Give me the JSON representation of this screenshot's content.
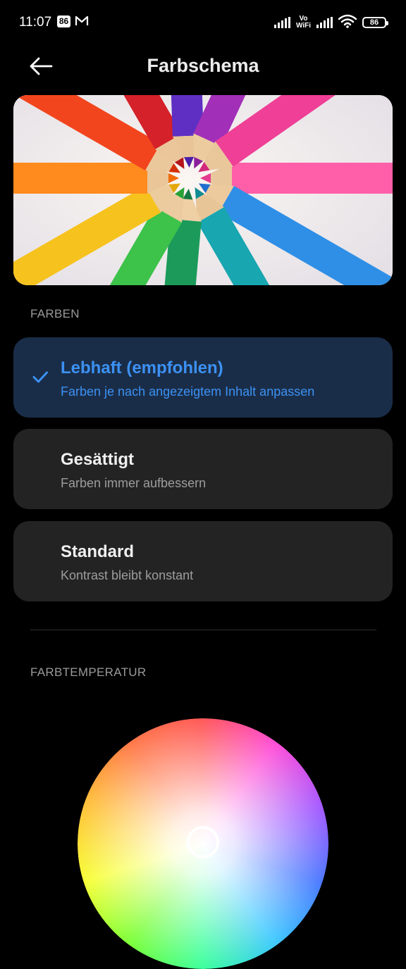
{
  "status_bar": {
    "time": "11:07",
    "badge": "86",
    "mail_icon": "gmail-m-icon",
    "vowifi": [
      "Vo",
      "WiFi"
    ],
    "battery": "86"
  },
  "header": {
    "title": "Farbschema",
    "back_icon": "arrow-left-icon"
  },
  "colors_section": {
    "label": "FARBEN",
    "options": [
      {
        "title": "Lebhaft (empfohlen)",
        "subtitle": "Farben je nach angezeigtem Inhalt anpassen",
        "selected": true
      },
      {
        "title": "Gesättigt",
        "subtitle": "Farben immer aufbessern",
        "selected": false
      },
      {
        "title": "Standard",
        "subtitle": "Kontrast bleibt konstant",
        "selected": false
      }
    ]
  },
  "temperature_section": {
    "label": "FARBTEMPERATUR"
  },
  "theme": {
    "background": "#000000",
    "card": "#232323",
    "selected_card": "#1a2d48",
    "accent": "#3c91f3"
  }
}
